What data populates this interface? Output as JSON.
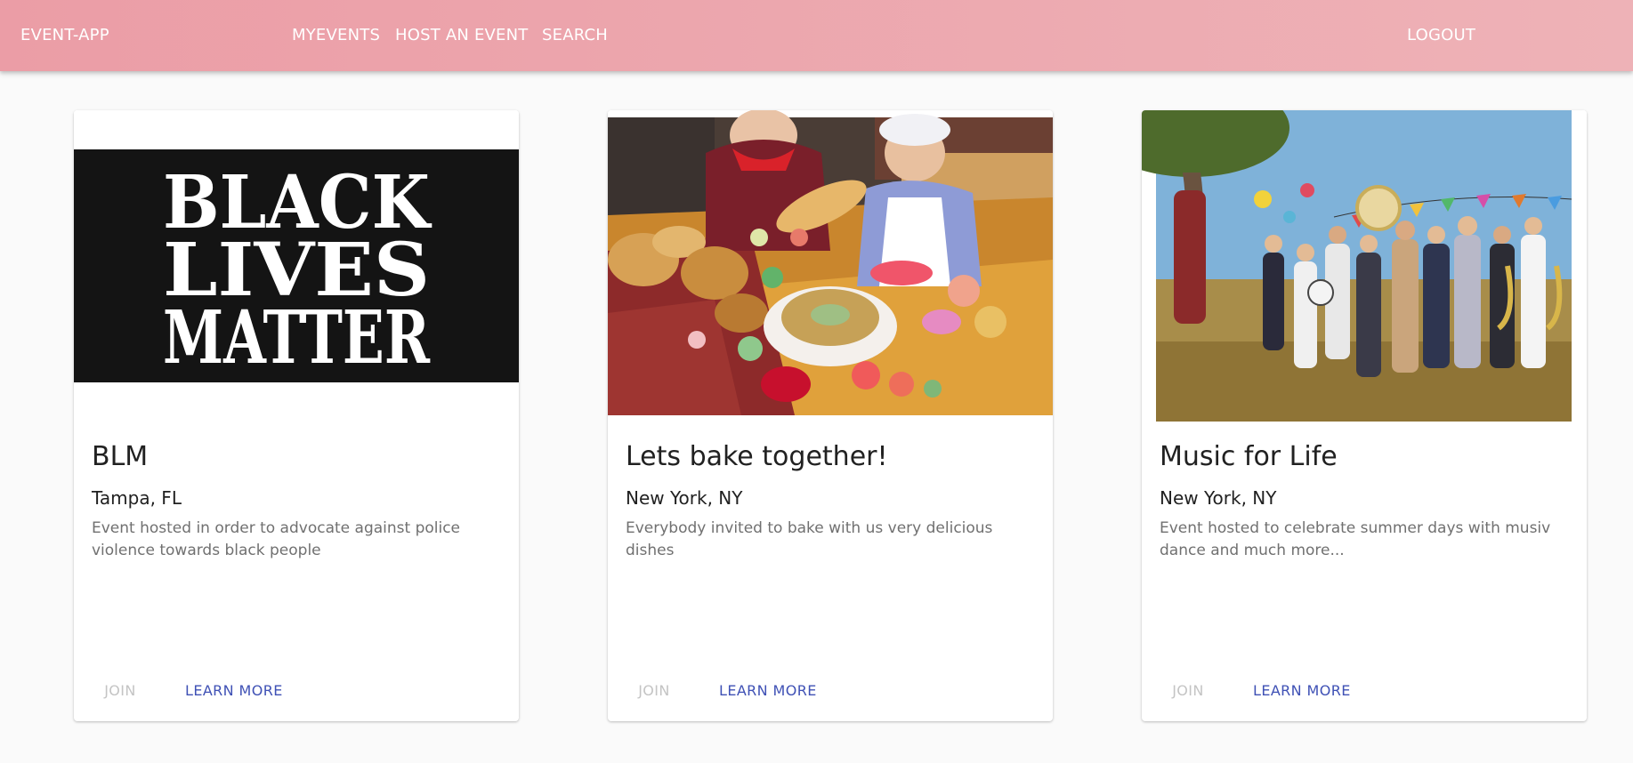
{
  "colors": {
    "appbar_start": "#eb9da6",
    "appbar_end": "#eeb2b7",
    "page_background": "#fafafa",
    "primary_button": "#3f51b5",
    "disabled_button": "#c4c4c4"
  },
  "appbar": {
    "brand": "EVENT-APP",
    "nav": {
      "myevents": "MYEVENTS",
      "host": "HOST AN EVENT",
      "search": "SEARCH"
    },
    "logout": "LOGOUT"
  },
  "events": [
    {
      "image_icon": "black-lives-matter-banner",
      "image_text": [
        "BLACK",
        "LIVES",
        "MATTER"
      ],
      "title": "BLM",
      "location": "Tampa, FL",
      "description": "Event hosted in order to advocate against police\nviolence towards black people",
      "join_label": "JOIN",
      "learn_label": "LEARN MORE",
      "join_disabled": true
    },
    {
      "image_icon": "baking-photo",
      "title": "Lets bake together!",
      "location": "New York, NY",
      "description": "Everybody invited to bake with us very delicious\ndishes",
      "join_label": "JOIN",
      "learn_label": "LEARN MORE",
      "join_disabled": true
    },
    {
      "image_icon": "music-festival-photo",
      "title": "Music for Life",
      "location": "New York, NY",
      "description": "Event hosted to celebrate summer days with musiv\ndance and much more...",
      "join_label": "JOIN",
      "learn_label": "LEARN MORE",
      "join_disabled": true
    }
  ]
}
